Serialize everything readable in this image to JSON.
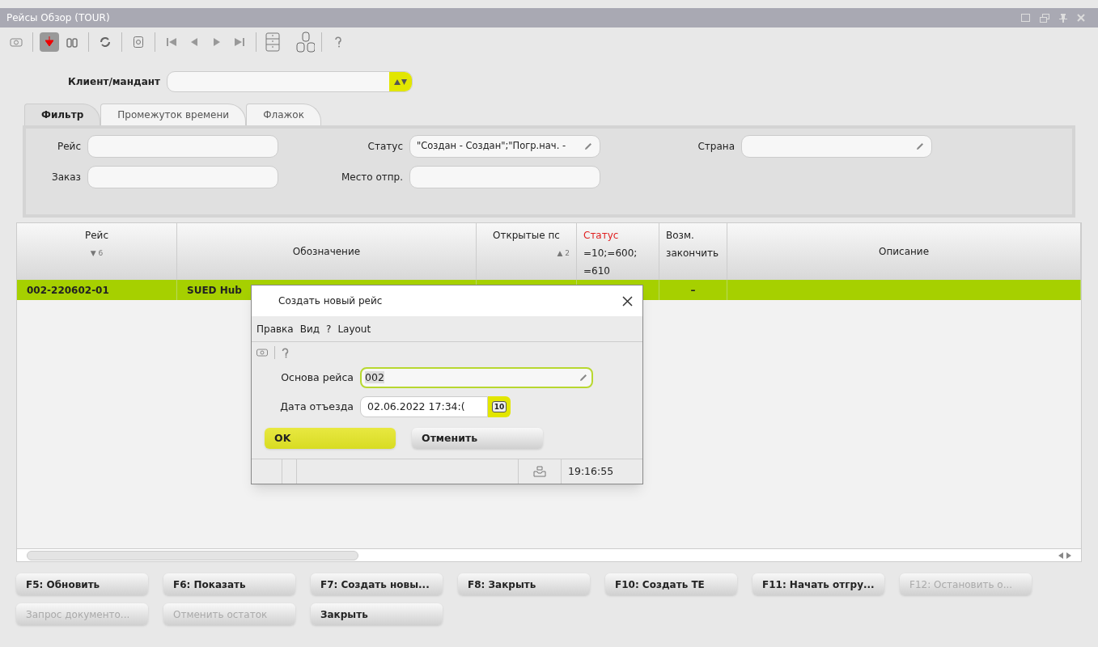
{
  "window": {
    "title": "Рейсы Обзор (TOUR)"
  },
  "client": {
    "label": "Клиент/мандант"
  },
  "tabs": [
    {
      "label": "Фильтр",
      "selected": true
    },
    {
      "label": "Промежуток времени",
      "selected": false
    },
    {
      "label": "Флажок",
      "selected": false
    }
  ],
  "filters": [
    {
      "label": "Рейс",
      "editable": false
    },
    {
      "label": "Статус",
      "value": "\"Создан - Создан\";\"Погр.нач. -",
      "editable": true
    },
    {
      "label": "Страна",
      "editable": true
    },
    {
      "label": "Заказ",
      "editable": false
    },
    {
      "label": "Место отпр.",
      "editable": false
    }
  ],
  "table": {
    "columns": [
      {
        "lines": [
          "Рейс"
        ],
        "sort": "▼ 6",
        "highlight": false
      },
      {
        "lines": [
          "Обозначение"
        ],
        "highlight": false
      },
      {
        "lines": [
          "Открытые пс"
        ],
        "sort": "▲ 2",
        "highlight": false
      },
      {
        "lines": [
          "Статус",
          "=10;=600;",
          "=610"
        ],
        "highlight": true
      },
      {
        "lines": [
          "Возм.",
          "закончить"
        ],
        "highlight": false
      },
      {
        "lines": [
          "Описание"
        ],
        "highlight": false
      }
    ],
    "rows": [
      {
        "cells": [
          "002-220602-01",
          "SUED Hub",
          "",
          "",
          "–",
          ""
        ],
        "selected": true
      }
    ]
  },
  "buttons": [
    {
      "label": "F5: Обновить",
      "disabled": false
    },
    {
      "label": "F6: Показать",
      "disabled": false
    },
    {
      "label": "F7: Создать новы...",
      "disabled": false
    },
    {
      "label": "F8: Закрыть",
      "disabled": false
    },
    {
      "label": "F10: Создать ТЕ",
      "disabled": false
    },
    {
      "label": "F11: Начать отгру...",
      "disabled": false
    },
    {
      "label": "F12: Остановить о...",
      "disabled": true
    },
    {
      "label": "Запрос документо...",
      "disabled": true
    },
    {
      "label": "Отменить остаток",
      "disabled": true
    },
    {
      "label": "Закрыть",
      "disabled": false
    }
  ],
  "dialog": {
    "title": "Создать новый рейс",
    "menu": [
      "Правка",
      "Вид",
      "?",
      "Layout"
    ],
    "fields": [
      {
        "label": "Основа рейса",
        "value": "002",
        "kind": "text"
      },
      {
        "label": "Дата отъезда",
        "value": "02.06.2022 17:34:(",
        "kind": "date"
      }
    ],
    "calendar_day": "10",
    "buttons": [
      {
        "label": "OK",
        "primary": true
      },
      {
        "label": "Отменить",
        "primary": false
      }
    ],
    "status_time": "19:16:55"
  }
}
